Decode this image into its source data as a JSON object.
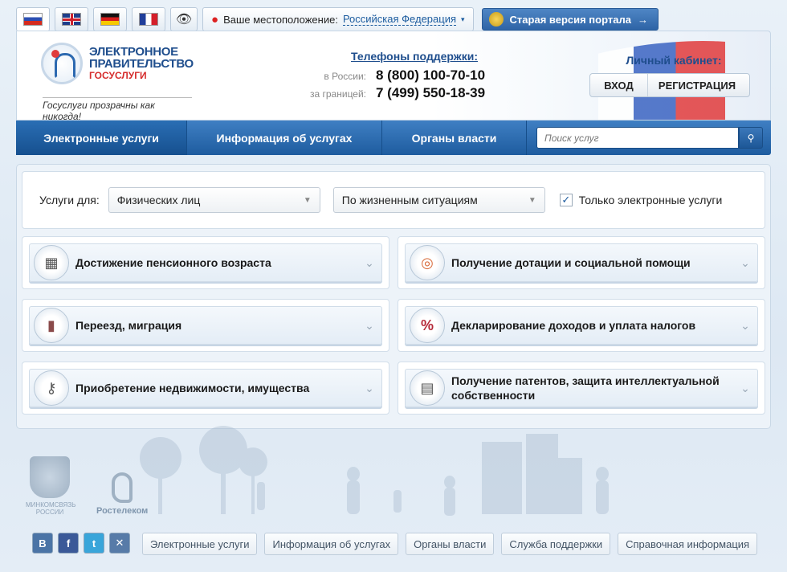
{
  "topbar": {
    "languages": [
      "ru",
      "en",
      "de",
      "fr"
    ],
    "location_label": "Ваше местоположение:",
    "location_value": "Российская Федерация",
    "old_version": "Старая версия портала"
  },
  "header": {
    "logo": {
      "line1": "ЭЛЕКТРОННОЕ",
      "line2": "ПРАВИТЕЛЬСТВО",
      "line3": "ГОСУСЛУГИ"
    },
    "slogan": "Госуслуги прозрачны как никогда!",
    "support": {
      "title": "Телефоны поддержки:",
      "phones": [
        {
          "label": "в России:",
          "number": "8 (800) 100-70-10"
        },
        {
          "label": "за границей:",
          "number": "7 (499) 550-18-39"
        }
      ]
    },
    "cabinet": {
      "title": "Личный кабинет:",
      "login": "ВХОД",
      "register": "РЕГИСТРАЦИЯ"
    }
  },
  "nav": {
    "items": [
      "Электронные услуги",
      "Информация об услугах",
      "Органы власти"
    ],
    "search_placeholder": "Поиск услуг"
  },
  "filter": {
    "label": "Услуги для:",
    "select1": "Физических лиц",
    "select2": "По жизненным ситуациям",
    "checkbox_label": "Только электронные услуги",
    "checkbox_checked": true
  },
  "categories": [
    {
      "label": "Достижение пенсионного возраста",
      "icon": "calendar-icon"
    },
    {
      "label": "Получение дотации и социальной помощи",
      "icon": "lifebuoy-icon"
    },
    {
      "label": "Переезд, миграция",
      "icon": "passport-icon"
    },
    {
      "label": "Декларирование доходов и уплата налогов",
      "icon": "percent-icon"
    },
    {
      "label": "Приобретение недвижимости, имущества",
      "icon": "keys-icon"
    },
    {
      "label": "Получение патентов, защита интеллектуальной собственности",
      "icon": "certificate-icon"
    }
  ],
  "footer": {
    "ministry_logo": "МИНКОМСВЯЗЬ РОССИИ",
    "rt_logo": "Ростелеком",
    "socials": [
      "В",
      "f",
      "t",
      "✕"
    ],
    "links": [
      "Электронные услуги",
      "Информация об услугах",
      "Органы власти",
      "Служба поддержки",
      "Справочная информация"
    ]
  }
}
